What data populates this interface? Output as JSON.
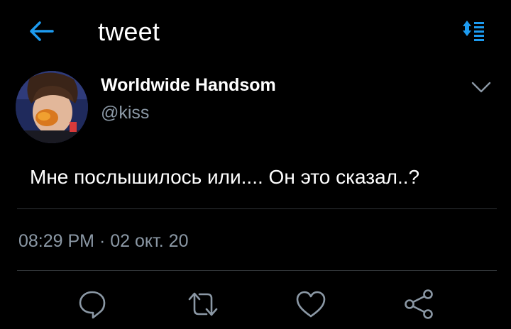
{
  "header": {
    "title": "tweet",
    "accent_color": "#1d9bf0",
    "back_icon": "arrow-left-icon",
    "sort_icon": "sort-list-icon"
  },
  "tweet": {
    "author": {
      "name": "Worldwide Handsom",
      "handle": "@kiss"
    },
    "text": "Мне послышилось или.... Он это сказал..?",
    "time": "08:29 PM",
    "separator": " · ",
    "date": "02 окт. 20"
  },
  "actions": [
    {
      "name": "reply",
      "icon": "reply-icon"
    },
    {
      "name": "retweet",
      "icon": "retweet-icon"
    },
    {
      "name": "like",
      "icon": "heart-icon"
    },
    {
      "name": "share",
      "icon": "share-icon"
    }
  ],
  "colors": {
    "background": "#000000",
    "text": "#ffffff",
    "secondary_text": "#8b98a5",
    "divider": "#2f3336",
    "icon": "#8b98a5"
  }
}
